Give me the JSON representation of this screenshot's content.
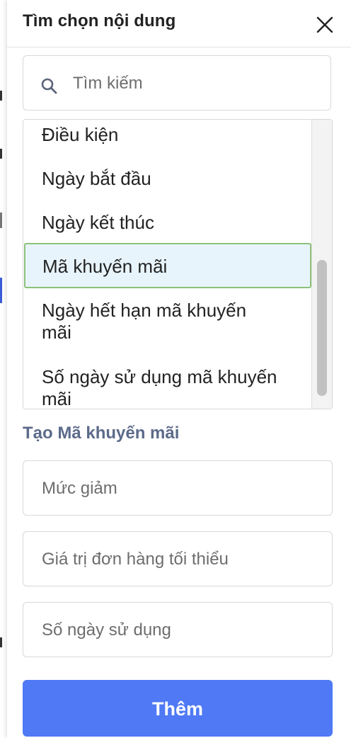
{
  "panel": {
    "title": "Tìm chọn nội dung",
    "close_icon": "close-icon"
  },
  "search": {
    "placeholder": "Tìm kiếm",
    "icon": "search-icon"
  },
  "list": {
    "items": [
      {
        "label": "Điều kiện",
        "selected": false
      },
      {
        "label": "Ngày bắt đầu",
        "selected": false
      },
      {
        "label": "Ngày kết thúc",
        "selected": false
      },
      {
        "label": "Mã khuyến mãi",
        "selected": true
      },
      {
        "label": "Ngày hết hạn mã khuyến mãi",
        "selected": false
      },
      {
        "label": "Số ngày sử dụng mã khuyến mãi",
        "selected": false
      }
    ]
  },
  "create": {
    "title": "Tạo Mã khuyến mãi",
    "fields": [
      {
        "placeholder": "Mức giảm"
      },
      {
        "placeholder": "Giá trị đơn hàng tối thiểu"
      },
      {
        "placeholder": "Số ngày sử dụng"
      }
    ],
    "submit_label": "Thêm"
  },
  "colors": {
    "primary_button": "#4f79f5",
    "selected_bg": "#e8f4fc",
    "selected_border": "#8cc27a",
    "section_title": "#5c6b8a"
  }
}
